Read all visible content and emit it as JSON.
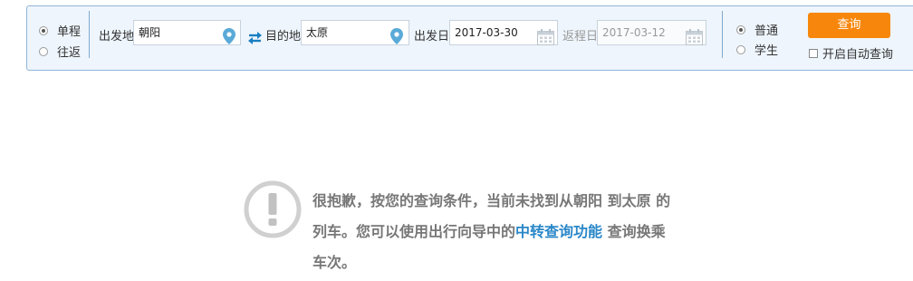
{
  "trip_type": {
    "one_way": "单程",
    "round_trip": "往返",
    "selected": "one_way"
  },
  "from": {
    "label": "出发地",
    "value": "朝阳"
  },
  "to": {
    "label": "目的地",
    "value": "太原"
  },
  "depart_date": {
    "label": "出发日",
    "value": "2017-03-30"
  },
  "return_date": {
    "label": "返程日",
    "value": "2017-03-12"
  },
  "passenger_type": {
    "normal": "普通",
    "student": "学生",
    "selected": "normal"
  },
  "query_button": "查询",
  "auto_query_label": "开启自动查询",
  "message": {
    "line1": "很抱歉，按您的查询条件，当前未找到从朝阳 到太原 的",
    "line2_before": "列车。您可以使用出行向导中的",
    "line2_link": "中转查询功能",
    "line2_after": " 查询换乘",
    "line3": "车次。"
  },
  "colors": {
    "accent": "#f7870c",
    "link": "#2a87c8",
    "border": "#8fb5d9",
    "icon_blue": "#5aaad8"
  }
}
